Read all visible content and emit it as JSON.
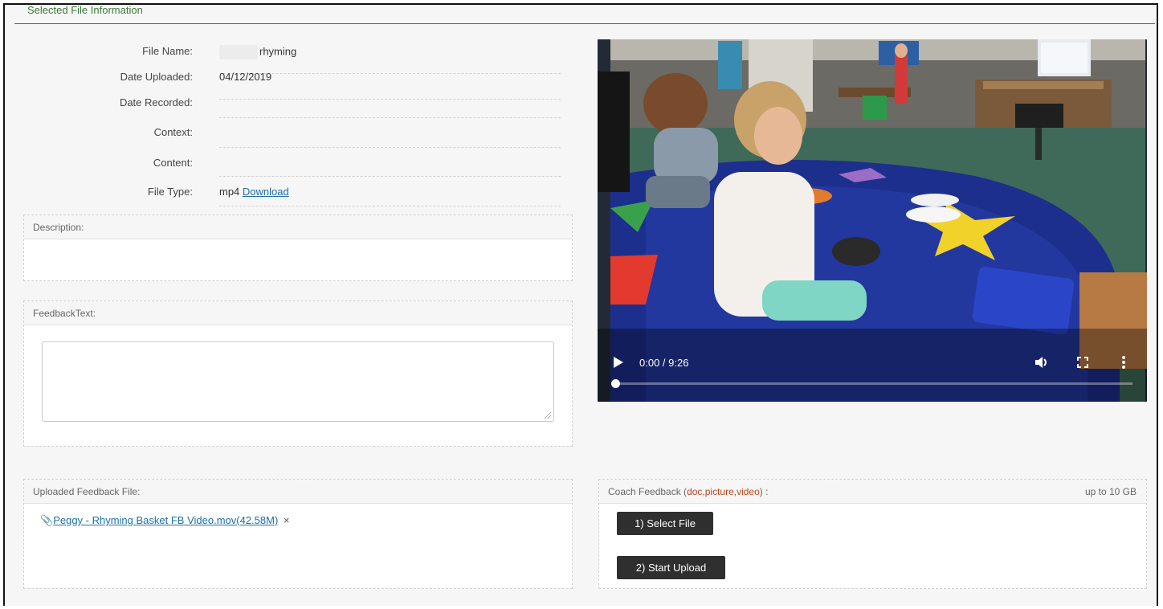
{
  "section_title": "Selected File Information",
  "file_info": {
    "file_name_label": "File Name:",
    "file_name_value": "rhyming",
    "date_uploaded_label": "Date Uploaded:",
    "date_uploaded_value": "04/12/2019",
    "date_recorded_label": "Date Recorded:",
    "date_recorded_value": "",
    "context_label": "Context:",
    "context_value": "",
    "content_label": "Content:",
    "content_value": "",
    "file_type_label": "File Type:",
    "file_type_value": "mp4",
    "download_label": "Download"
  },
  "description": {
    "label": "Description:",
    "value": ""
  },
  "feedback_text": {
    "label": "FeedbackText:",
    "value": ""
  },
  "video": {
    "time_display": "0:00 / 9:26",
    "progress": 0.0,
    "icons": [
      "play-icon",
      "volume-icon",
      "fullscreen-icon",
      "more-options-icon"
    ]
  },
  "uploaded_feedback": {
    "label": "Uploaded Feedback File:",
    "file_link": "Peggy - Rhyming Basket FB Video.mov(42.58M)",
    "remove_symbol": "×",
    "icon": "paperclip-icon"
  },
  "coach_feedback": {
    "label_prefix": "Coach Feedback (",
    "label_types": "doc,picture,video",
    "label_suffix": ") :",
    "limit": "up to 10 GB",
    "select_button": "1) Select File",
    "upload_button": "2) Start Upload"
  },
  "colors": {
    "accent_green": "#2e7d32",
    "link_blue": "#1f6fa6",
    "types_orange": "#c0461b",
    "button_dark": "#2f2f2f"
  }
}
